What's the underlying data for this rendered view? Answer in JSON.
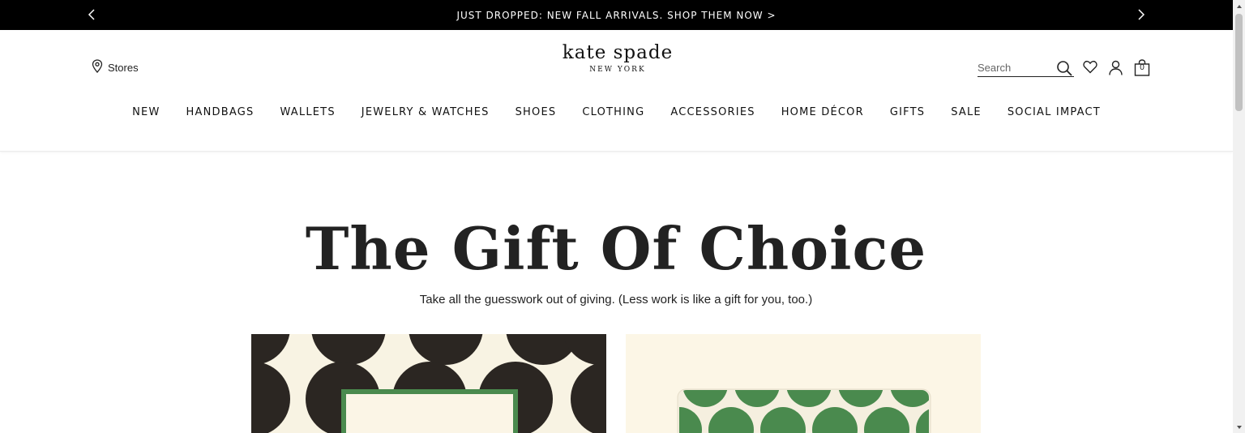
{
  "promo": {
    "text": "JUST DROPPED: NEW FALL ARRIVALS. SHOP THEM NOW >",
    "prev_icon": "chevron-left-icon",
    "next_icon": "chevron-right-icon"
  },
  "header": {
    "stores_label": "Stores",
    "logo_main": "kate spade",
    "logo_sub": "NEW YORK",
    "search_placeholder": "Search",
    "bag_count": "0"
  },
  "nav": {
    "items": [
      "NEW",
      "HANDBAGS",
      "WALLETS",
      "JEWELRY & WATCHES",
      "SHOES",
      "CLOTHING",
      "ACCESSORIES",
      "HOME DÉCOR",
      "GIFTS",
      "SALE",
      "SOCIAL IMPACT"
    ]
  },
  "hero": {
    "title": "The Gift Of Choice",
    "subtitle": "Take all the guesswork out of giving. (Less work is like a gift for you, too.)"
  },
  "colors": {
    "promo_bg": "#000000",
    "dot_dark": "#2b2622",
    "card_green": "#4a8a4e",
    "card_cream": "#fbf5e6"
  }
}
